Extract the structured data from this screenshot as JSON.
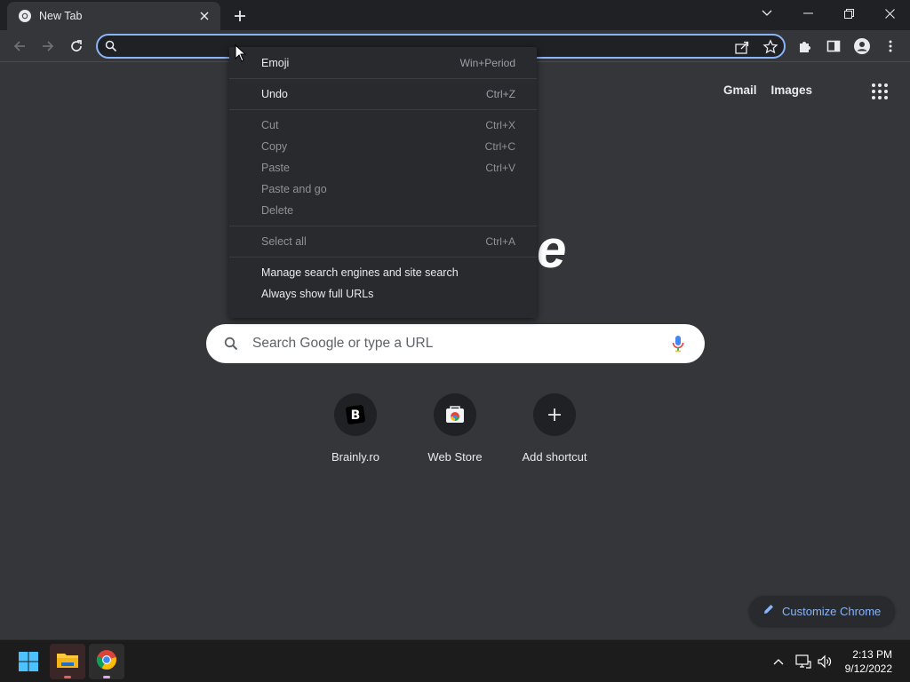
{
  "tab": {
    "title": "New Tab"
  },
  "omnibox": {
    "value": ""
  },
  "ntp": {
    "links": [
      "Gmail",
      "Images"
    ],
    "logo_fragment": "e",
    "search_placeholder": "Search Google or type a URL",
    "shortcuts": [
      {
        "label": "Brainly.ro",
        "icon": "brainly-icon"
      },
      {
        "label": "Web Store",
        "icon": "webstore-icon"
      },
      {
        "label": "Add shortcut",
        "icon": "plus-icon"
      }
    ],
    "customize_label": "Customize Chrome"
  },
  "context_menu": {
    "groups": [
      [
        {
          "label": "Emoji",
          "shortcut": "Win+Period",
          "enabled": true
        }
      ],
      [
        {
          "label": "Undo",
          "shortcut": "Ctrl+Z",
          "enabled": true
        }
      ],
      [
        {
          "label": "Cut",
          "shortcut": "Ctrl+X",
          "enabled": false
        },
        {
          "label": "Copy",
          "shortcut": "Ctrl+C",
          "enabled": false
        },
        {
          "label": "Paste",
          "shortcut": "Ctrl+V",
          "enabled": false
        },
        {
          "label": "Paste and go",
          "shortcut": "",
          "enabled": false
        },
        {
          "label": "Delete",
          "shortcut": "",
          "enabled": false
        }
      ],
      [
        {
          "label": "Select all",
          "shortcut": "Ctrl+A",
          "enabled": false
        }
      ],
      [
        {
          "label": "Manage search engines and site search",
          "shortcut": "",
          "enabled": true
        },
        {
          "label": "Always show full URLs",
          "shortcut": "",
          "enabled": true
        }
      ]
    ]
  },
  "taskbar": {
    "time": "2:13 PM",
    "date": "9/12/2022"
  },
  "colors": {
    "background": "#35363a",
    "accent": "#8ab4f8",
    "menu": "#292a2d"
  }
}
